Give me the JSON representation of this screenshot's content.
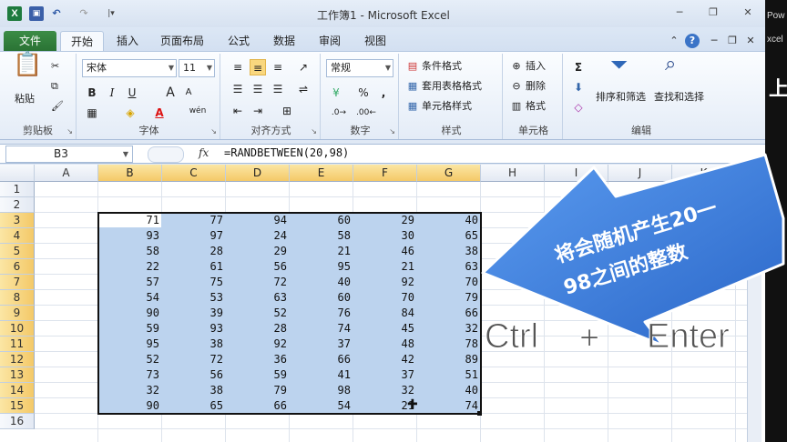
{
  "window": {
    "title": "工作簿1 - Microsoft Excel",
    "logo": "X",
    "qa_more": "|▾"
  },
  "right_strip": {
    "top_text": "Pow",
    "mid_text": "xcel",
    "big_text": "上"
  },
  "tabs": [
    "文件",
    "开始",
    "插入",
    "页面布局",
    "公式",
    "数据",
    "审阅",
    "视图"
  ],
  "ribbon": {
    "clipboard": {
      "label": "剪贴板",
      "paste": "粘贴"
    },
    "font": {
      "label": "字体",
      "name": "宋体",
      "size": "11",
      "bold": "B",
      "italic": "I",
      "underline": "U",
      "grow": "A",
      "shrink": "A",
      "phonetic": "wén"
    },
    "alignment": {
      "label": "对齐方式"
    },
    "number": {
      "label": "数字",
      "format": "常规",
      "percent": "%",
      "comma": ","
    },
    "styles": {
      "label": "样式",
      "items": [
        "条件格式",
        "套用表格格式",
        "单元格样式"
      ]
    },
    "cells": {
      "label": "单元格",
      "items": [
        "插入",
        "删除",
        "格式"
      ]
    },
    "editing": {
      "label": "编辑",
      "sort_filter": "排序和筛选",
      "find_select": "查找和选择",
      "sigma": "Σ"
    }
  },
  "formula_bar": {
    "cell_ref": "B3",
    "fx": "fx",
    "formula": "=RANDBETWEEN(20,98)"
  },
  "sheet": {
    "columns": [
      "A",
      "B",
      "C",
      "D",
      "E",
      "F",
      "G",
      "H",
      "I",
      "J",
      "K"
    ],
    "rows": [
      "1",
      "2",
      "3",
      "4",
      "5",
      "6",
      "7",
      "8",
      "9",
      "10",
      "11",
      "12",
      "13",
      "14",
      "15",
      "16"
    ],
    "data": [
      [
        71,
        77,
        94,
        60,
        29,
        40
      ],
      [
        93,
        97,
        24,
        58,
        30,
        65
      ],
      [
        58,
        28,
        29,
        21,
        46,
        38
      ],
      [
        22,
        61,
        56,
        95,
        21,
        63
      ],
      [
        57,
        75,
        72,
        40,
        92,
        70
      ],
      [
        54,
        53,
        63,
        60,
        70,
        79
      ],
      [
        90,
        39,
        52,
        76,
        84,
        66
      ],
      [
        59,
        93,
        28,
        74,
        45,
        32
      ],
      [
        95,
        38,
        92,
        37,
        48,
        78
      ],
      [
        52,
        72,
        36,
        66,
        42,
        89
      ],
      [
        73,
        56,
        59,
        41,
        37,
        51
      ],
      [
        32,
        38,
        79,
        98,
        32,
        40
      ],
      [
        90,
        65,
        66,
        54,
        21,
        74
      ]
    ]
  },
  "annotation": {
    "callout_line1": "将会随机产生20一",
    "callout_line2": "98之间的整数",
    "key1": "Ctrl",
    "plus": "+",
    "key2": "Enter",
    "arrow_color": "#3b7dd8"
  }
}
